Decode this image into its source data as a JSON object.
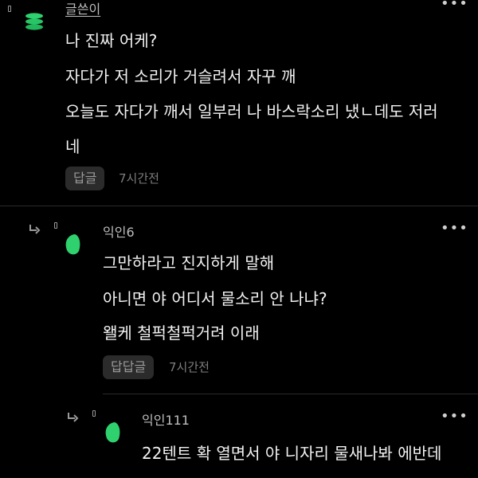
{
  "comments": [
    {
      "author": "글쓴이",
      "lines": [
        "나 진짜 어케?",
        "자다가 저 소리가 거슬려서 자꾸 깨",
        "오늘도 자다가 깨서 일부러 나 바스락소리 냈ㄴ데도 저러",
        "네"
      ],
      "reply_label": "답글",
      "time": "7시간전",
      "avatar_icon": "green-stack-icon",
      "more_icon": "more-options-icon"
    },
    {
      "author": "익인6",
      "lines": [
        "그만하라고 진지하게 말해",
        "아니면 야 어디서 물소리 안 나냐?",
        "왤케 철퍽철퍽거려 이래"
      ],
      "reply_label": "답답글",
      "time": "7시간전",
      "avatar_icon": "green-bean-icon",
      "more_icon": "more-options-icon",
      "reply_icon": "reply-arrow-icon"
    },
    {
      "author": "익인111",
      "lines": [
        "22텐트 확 열면서 야 니자리 물새나봐 에반데"
      ],
      "avatar_icon": "green-bean-icon",
      "more_icon": "more-options-icon",
      "reply_icon": "reply-arrow-icon"
    }
  ],
  "colors": {
    "background": "#000000",
    "text": "#f2f2f2",
    "muted": "#9a9a9a",
    "accent_green": "#2fd16f"
  }
}
